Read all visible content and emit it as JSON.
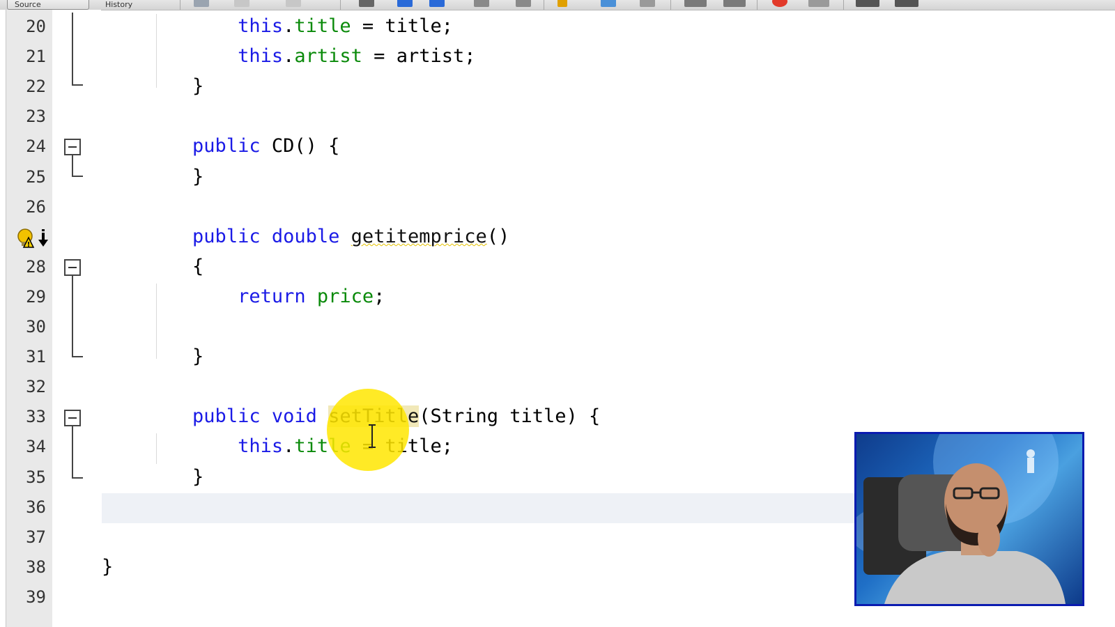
{
  "toolbar": {
    "tab_label": "Source",
    "history_label": "History"
  },
  "editor": {
    "lines": [
      {
        "num": "20",
        "tokens": [
          {
            "t": "            ",
            "c": ""
          },
          {
            "t": "this",
            "c": "kw"
          },
          {
            "t": ".",
            "c": ""
          },
          {
            "t": "title",
            "c": "fld"
          },
          {
            "t": " = title;",
            "c": ""
          }
        ]
      },
      {
        "num": "21",
        "tokens": [
          {
            "t": "            ",
            "c": ""
          },
          {
            "t": "this",
            "c": "kw"
          },
          {
            "t": ".",
            "c": ""
          },
          {
            "t": "artist",
            "c": "fld"
          },
          {
            "t": " = artist;",
            "c": ""
          }
        ]
      },
      {
        "num": "22",
        "tokens": [
          {
            "t": "        }",
            "c": ""
          }
        ]
      },
      {
        "num": "23",
        "tokens": []
      },
      {
        "num": "24",
        "tokens": [
          {
            "t": "        ",
            "c": ""
          },
          {
            "t": "public",
            "c": "kw"
          },
          {
            "t": " CD() {",
            "c": ""
          }
        ]
      },
      {
        "num": "25",
        "tokens": [
          {
            "t": "        }",
            "c": ""
          }
        ]
      },
      {
        "num": "26",
        "tokens": []
      },
      {
        "num": "",
        "tokens": [
          {
            "t": "        ",
            "c": ""
          },
          {
            "t": "public",
            "c": "kw"
          },
          {
            "t": " ",
            "c": ""
          },
          {
            "t": "double",
            "c": "kw"
          },
          {
            "t": " ",
            "c": ""
          },
          {
            "t": "getitemprice",
            "c": "warn"
          },
          {
            "t": "()",
            "c": ""
          }
        ]
      },
      {
        "num": "28",
        "tokens": [
          {
            "t": "        {",
            "c": ""
          }
        ]
      },
      {
        "num": "29",
        "tokens": [
          {
            "t": "            ",
            "c": ""
          },
          {
            "t": "return",
            "c": "kw"
          },
          {
            "t": " ",
            "c": ""
          },
          {
            "t": "price",
            "c": "fld"
          },
          {
            "t": ";",
            "c": ""
          }
        ]
      },
      {
        "num": "30",
        "tokens": []
      },
      {
        "num": "31",
        "tokens": [
          {
            "t": "        }",
            "c": ""
          }
        ]
      },
      {
        "num": "32",
        "tokens": []
      },
      {
        "num": "33",
        "tokens": [
          {
            "t": "        ",
            "c": ""
          },
          {
            "t": "public",
            "c": "kw"
          },
          {
            "t": " ",
            "c": ""
          },
          {
            "t": "void",
            "c": "kw"
          },
          {
            "t": " ",
            "c": ""
          },
          {
            "t": "setTitle",
            "c": "hl"
          },
          {
            "t": "(String title) {",
            "c": ""
          }
        ]
      },
      {
        "num": "34",
        "tokens": [
          {
            "t": "            ",
            "c": ""
          },
          {
            "t": "this",
            "c": "kw"
          },
          {
            "t": ".",
            "c": ""
          },
          {
            "t": "title",
            "c": "fld"
          },
          {
            "t": " = title;",
            "c": ""
          }
        ]
      },
      {
        "num": "35",
        "tokens": [
          {
            "t": "        }",
            "c": ""
          }
        ]
      },
      {
        "num": "36",
        "tokens": []
      },
      {
        "num": "37",
        "tokens": []
      },
      {
        "num": "38",
        "tokens": [
          {
            "t": "}",
            "c": ""
          }
        ]
      },
      {
        "num": "39",
        "tokens": []
      }
    ]
  },
  "gutter": {
    "hint_icon": "lightbulb-warning-icon"
  },
  "colors": {
    "keyword": "#1a1ae6",
    "field": "#0a8a0a",
    "gutter_bg": "#e9e9e9",
    "cursor_highlight": "#ffe600",
    "webcam_border": "#0a1bb0"
  }
}
